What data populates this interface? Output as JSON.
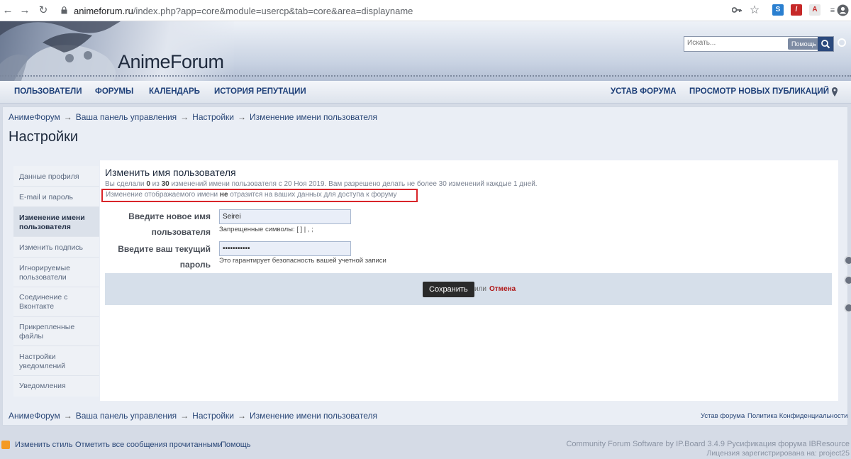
{
  "browser": {
    "url_host": "animeforum.ru",
    "url_path": "/index.php?app=core&module=usercp&tab=core&area=displayname"
  },
  "header": {
    "logo_text": "AnimeForum",
    "search_placeholder": "Искать...",
    "search_help": "Помощь"
  },
  "nav": {
    "left": [
      "ПОЛЬЗОВАТЕЛИ",
      "ФОРУМЫ",
      "КАЛЕНДАРЬ",
      "ИСТОРИЯ РЕПУТАЦИИ"
    ],
    "right": [
      "УСТАВ ФОРУМА",
      "ПРОСМОТР НОВЫХ ПУБЛИКАЦИЙ"
    ]
  },
  "breadcrumb": [
    "АнимеФорум",
    "Ваша панель управления",
    "Настройки",
    "Изменение имени пользователя"
  ],
  "breadcrumb_sep": "→",
  "page_title": "Настройки",
  "sidebar": [
    "Данные профиля",
    "E-mail и пароль",
    "Изменение имени пользователя",
    "Изменить подпись",
    "Игнорируемые пользователи",
    "Соединение с Вконтакте",
    "Прикрепленные файлы",
    "Настройки уведомлений",
    "Уведомления"
  ],
  "content": {
    "heading": "Изменить имя пользователя",
    "info_prefix": "Вы сделали",
    "info_count": "0",
    "info_mid": "из",
    "info_total": "30",
    "info_suffix": "изменений имени пользователя с 20 Ноя 2019. Вам разрешено делать не более 30 изменений каждые 1 дней.",
    "warn_prefix": "Изменение отображаемого имени",
    "warn_bold": "не",
    "warn_suffix": "отразится на ваших данных для доступа к форуму",
    "label_new_name_1": "Введите новое имя",
    "label_new_name_2": "пользователя",
    "new_name_value": "Seirei",
    "new_name_hint": "Запрещенные символы: [ ] | , ;",
    "label_password_1": "Введите ваш текущий",
    "label_password_2": "пароль",
    "password_value": "•••••••••••",
    "password_hint": "Это гарантирует безопасность вашей учетной записи",
    "save_label": "Сохранить",
    "or_text": "или",
    "cancel_label": "Отмена"
  },
  "footer": {
    "links": [
      "Устав форума",
      "Политика Конфиденциальности"
    ],
    "separator": "·",
    "bottom_links": [
      "Изменить стиль",
      "Отметить все сообщения прочитанными",
      "Помощь"
    ],
    "credit_line1": "Community Forum Software by IP.Board 3.4.9 Русификация форума IBResource",
    "credit_line2": "Лицензия зарегистрирована на: project25"
  },
  "colors": {
    "accent": "#1d3f78",
    "warn_border": "#d9252a",
    "cancel": "#b01818"
  }
}
